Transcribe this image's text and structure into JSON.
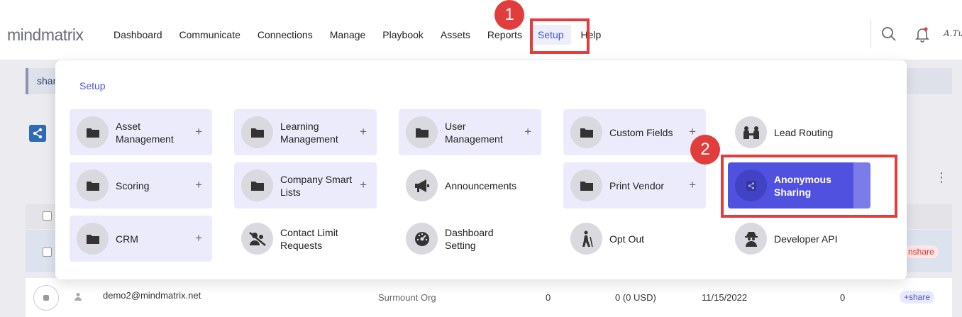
{
  "logo": "mindmatrix",
  "nav": {
    "items": [
      "Dashboard",
      "Communicate",
      "Connections",
      "Manage",
      "Playbook",
      "Assets",
      "Reports"
    ],
    "active": "Setup",
    "after": "Help"
  },
  "signature": "A.Tush",
  "background": {
    "bar_text": "shar",
    "row": {
      "email": "demo2@mindmatrix.net",
      "org": "Surmount Org",
      "count1": "0",
      "amount": "0 (0 USD)",
      "date": "11/15/2022",
      "count2": "0",
      "share_pill": "+share",
      "unshare_pill": "nshare"
    }
  },
  "panel": {
    "title": "Setup",
    "tiles": [
      {
        "label": "Asset Management",
        "icon": "folder-icon",
        "plus": "+"
      },
      {
        "label": "Learning Management",
        "icon": "folder-icon",
        "plus": "+"
      },
      {
        "label": "User Management",
        "icon": "folder-icon",
        "plus": "+"
      },
      {
        "label": "Custom Fields",
        "icon": "folder-icon",
        "plus": "+"
      },
      {
        "label": "Lead Routing",
        "icon": "people-routing-icon"
      },
      {
        "label": "Scoring",
        "icon": "folder-icon",
        "plus": "+"
      },
      {
        "label": "Company Smart Lists",
        "icon": "folder-icon",
        "plus": "+"
      },
      {
        "label": "Announcements",
        "icon": "megaphone-icon"
      },
      {
        "label": "Print Vendor",
        "icon": "folder-icon",
        "plus": "+"
      },
      {
        "label": "Anonymous Sharing",
        "icon": "share-icon"
      },
      {
        "label": "CRM",
        "icon": "folder-icon",
        "plus": "+"
      },
      {
        "label": "Contact Limit Requests",
        "icon": "users-off-icon"
      },
      {
        "label": "Dashboard Setting",
        "icon": "gauge-icon"
      },
      {
        "label": "Opt Out",
        "icon": "walking-icon"
      },
      {
        "label": "Developer API",
        "icon": "spy-icon"
      }
    ]
  },
  "annotations": [
    "1",
    "2"
  ],
  "colors": {
    "accent": "#4a55c9",
    "selected": "#5151e0",
    "annotation": "#e23d3d",
    "tile_bg": "#ecebfb"
  }
}
